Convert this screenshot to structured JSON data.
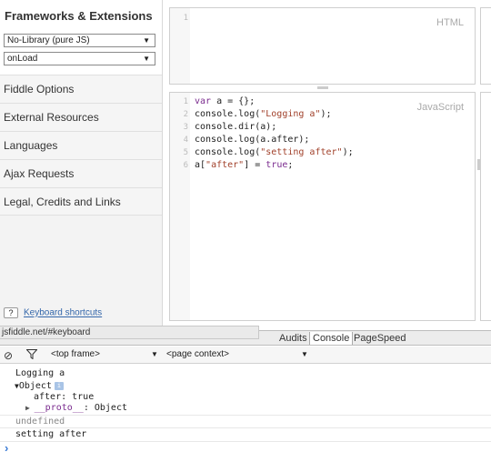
{
  "sidebar": {
    "title": "Frameworks & Extensions",
    "library_select": "No-Library (pure JS)",
    "load_select": "onLoad",
    "items": [
      {
        "label": "Fiddle Options"
      },
      {
        "label": "External Resources"
      },
      {
        "label": "Languages"
      },
      {
        "label": "Ajax Requests"
      },
      {
        "label": "Legal, Credits and Links"
      }
    ],
    "keyboard_q": "?",
    "keyboard_link": "Keyboard shortcuts"
  },
  "html_panel": {
    "label": "HTML",
    "line": "1"
  },
  "js_panel": {
    "label": "JavaScript",
    "lines": [
      "1",
      "2",
      "3",
      "4",
      "5",
      "6"
    ]
  },
  "url_tooltip": "jsfiddle.net/#keyboard",
  "devtools": {
    "tabs": [
      "Audits",
      "Console",
      "PageSpeed"
    ],
    "frame_select": "<top frame>",
    "context_select": "<page context>",
    "console": {
      "line1": "Logging a",
      "obj": "Object",
      "obj_prop": "after: true",
      "proto_key": "__proto__",
      "proto_val": ": Object",
      "undef": "undefined",
      "setting": "setting after",
      "prompt": "›"
    }
  },
  "colors": {
    "keyword": "#7a2b8e",
    "string": "#a1402a",
    "link": "#3366aa"
  }
}
